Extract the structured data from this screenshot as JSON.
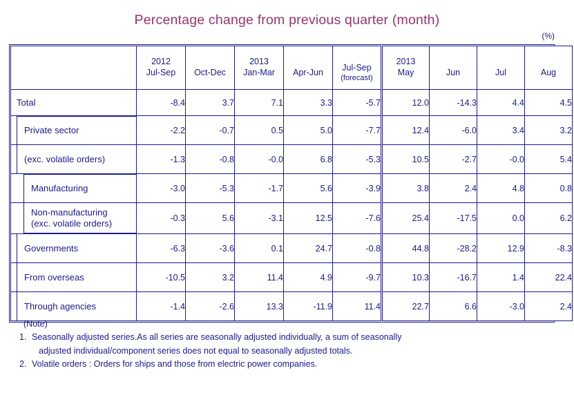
{
  "title": "Percentage change from previous quarter (month)",
  "unit_label": "(%)",
  "table": {
    "columns": [
      {
        "id": "label",
        "year": "",
        "period": "",
        "sub": ""
      },
      {
        "id": "2012q3",
        "year": "2012",
        "period": "Jul-Sep",
        "sub": ""
      },
      {
        "id": "2012q4",
        "year": "",
        "period": "Oct-Dec",
        "sub": ""
      },
      {
        "id": "2013q1",
        "year": "2013",
        "period": "Jan-Mar",
        "sub": ""
      },
      {
        "id": "2013q2",
        "year": "",
        "period": "Apr-Jun",
        "sub": ""
      },
      {
        "id": "2013q3",
        "year": "",
        "period": "Jul-Sep",
        "sub": "(forecast)"
      },
      {
        "id": "2013may",
        "year": "2013",
        "period": "May",
        "sub": ""
      },
      {
        "id": "2013jun",
        "year": "",
        "period": "Jun",
        "sub": ""
      },
      {
        "id": "2013jul",
        "year": "",
        "period": "Jul",
        "sub": ""
      },
      {
        "id": "2013aug",
        "year": "",
        "period": "Aug",
        "sub": ""
      }
    ],
    "rows": [
      {
        "id": "total",
        "label": "Total",
        "indent": 0,
        "values": [
          "-8.4",
          "3.7",
          "7.1",
          "3.3",
          "-5.7",
          "12.0",
          "-14.3",
          "4.4",
          "4.5"
        ]
      },
      {
        "id": "private-sector",
        "label": "Private sector",
        "indent": 1,
        "values": [
          "-2.2",
          "-0.7",
          "0.5",
          "5.0",
          "-7.7",
          "12.4",
          "-6.0",
          "3.4",
          "3.2"
        ]
      },
      {
        "id": "private-sector-exc-volatile",
        "label": "(exc. volatile orders)",
        "indent": 1,
        "values": [
          "-1.3",
          "-0.8",
          "-0.0",
          "6.8",
          "-5.3",
          "10.5",
          "-2.7",
          "-0.0",
          "5.4"
        ]
      },
      {
        "id": "manufacturing",
        "label": "Manufacturing",
        "indent": 2,
        "values": [
          "-3.0",
          "-5.3",
          "-1.7",
          "5.6",
          "-3.9",
          "3.8",
          "2.4",
          "4.8",
          "0.8"
        ]
      },
      {
        "id": "non-manufacturing",
        "label": "Non-manufacturing\n(exc. volatile orders)",
        "indent": 2,
        "values": [
          "-0.3",
          "5.6",
          "-3.1",
          "12.5",
          "-7.6",
          "25.4",
          "-17.5",
          "0.0",
          "6.2"
        ]
      },
      {
        "id": "governments",
        "label": "Governments",
        "indent": 1,
        "values": [
          "-6.3",
          "-3.6",
          "0.1",
          "24.7",
          "-0.8",
          "44.8",
          "-28.2",
          "12.9",
          "-8.3"
        ]
      },
      {
        "id": "from-overseas",
        "label": "From overseas",
        "indent": 1,
        "values": [
          "-10.5",
          "3.2",
          "11.4",
          "4.9",
          "-9.7",
          "10.3",
          "-16.7",
          "1.4",
          "22.4"
        ]
      },
      {
        "id": "through-agencies",
        "label": "Through agencies",
        "indent": 1,
        "values": [
          "-1.4",
          "-2.6",
          "13.3",
          "-11.9",
          "11.4",
          "22.7",
          "6.6",
          "-3.0",
          "2.4"
        ]
      }
    ]
  },
  "notes": {
    "heading": "(Note)",
    "items": [
      {
        "number": "1.",
        "line1": "Seasonally adjusted series.As all series are seasonally adjusted individually,  a sum of seasonally",
        "line2": "adjusted individual/component series does not equal to seasonally adjusted totals."
      },
      {
        "number": "2.",
        "line1": "Volatile orders : Orders for ships and those from electric power companies.",
        "line2": ""
      }
    ]
  },
  "colors": {
    "title": "#99336b",
    "border": "#1a1a8c",
    "label_text": "#1a1a8c",
    "value_text": "#11661a"
  }
}
